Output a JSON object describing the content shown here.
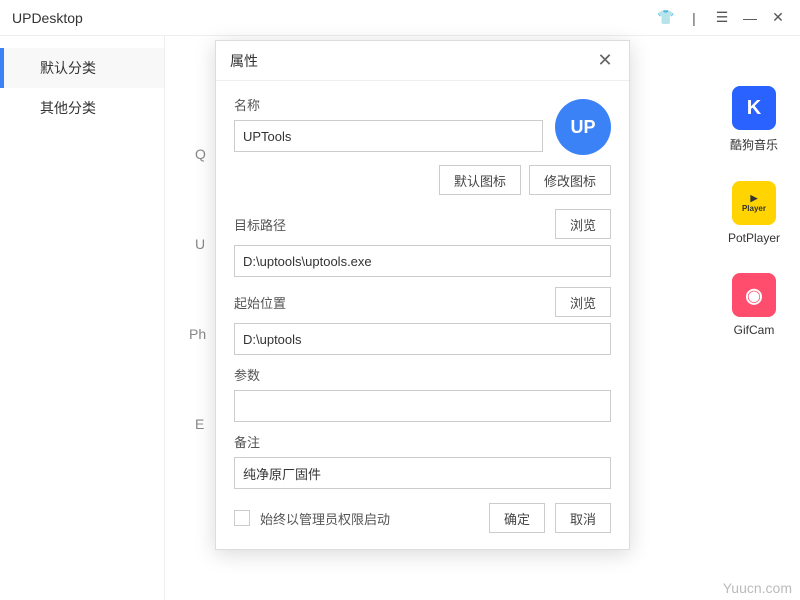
{
  "titlebar": {
    "title": "UPDesktop"
  },
  "sidebar": {
    "items": [
      {
        "label": "默认分类"
      },
      {
        "label": "其他分类"
      }
    ]
  },
  "bg": {
    "q": "Q",
    "u": "U",
    "ph": "Ph",
    "e": "E"
  },
  "apps": [
    {
      "label": "酷狗音乐",
      "icon": "K"
    },
    {
      "label": "PotPlayer",
      "icon": "▶"
    },
    {
      "label": "GifCam",
      "icon": "◉"
    }
  ],
  "dialog": {
    "title": "属性",
    "name_label": "名称",
    "name_value": "UPTools",
    "default_icon_btn": "默认图标",
    "change_icon_btn": "修改图标",
    "target_label": "目标路径",
    "browse_btn": "浏览",
    "target_value": "D:\\uptools\\uptools.exe",
    "start_label": "起始位置",
    "start_value": "D:\\uptools",
    "args_label": "参数",
    "args_value": "",
    "remark_label": "备注",
    "remark_value": "纯净原厂固件",
    "admin_label": "始终以管理员权限启动",
    "ok_btn": "确定",
    "cancel_btn": "取消",
    "icon_text": "UP"
  },
  "watermark": "Yuucn.com"
}
